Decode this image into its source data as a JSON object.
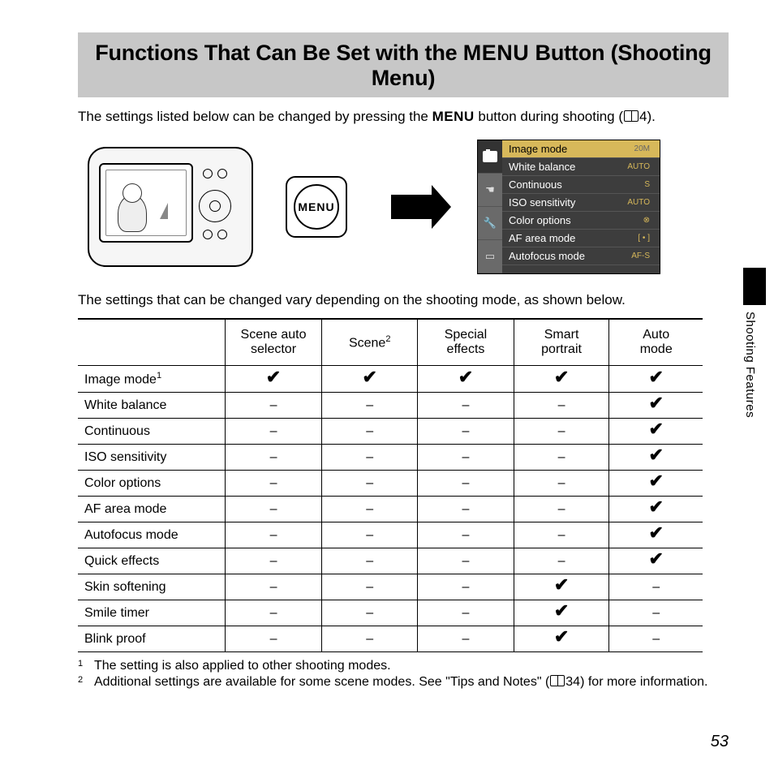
{
  "title": {
    "prefix": "Functions That Can Be Set with the ",
    "menu_word": "MENU",
    "suffix": " Button (Shooting Menu)"
  },
  "intro": {
    "prefix": "The settings listed below can be changed by pressing the ",
    "menu_word": "MENU",
    "mid": " button during shooting (",
    "ref": "4",
    "suffix": ")."
  },
  "menu_button_label": "MENU",
  "menu_screen": {
    "items": [
      {
        "label": "Image mode",
        "value": "20M",
        "selected": true
      },
      {
        "label": "White balance",
        "value": "AUTO"
      },
      {
        "label": "Continuous",
        "value": "S"
      },
      {
        "label": "ISO sensitivity",
        "value": "AUTO"
      },
      {
        "label": "Color options",
        "value": "⊗"
      },
      {
        "label": "AF area mode",
        "value": "[ • ]"
      },
      {
        "label": "Autofocus mode",
        "value": "AF-S"
      }
    ]
  },
  "para2": "The settings that can be changed vary depending on the shooting mode, as shown below.",
  "table": {
    "columns": [
      "Scene auto selector",
      "Scene",
      "Special effects",
      "Smart portrait",
      "Auto mode"
    ],
    "column_sup": [
      "",
      "2",
      "",
      "",
      ""
    ],
    "rows": [
      {
        "label": "Image mode",
        "sup": "1",
        "cells": [
          "w",
          "w",
          "w",
          "w",
          "w"
        ]
      },
      {
        "label": "White balance",
        "sup": "",
        "cells": [
          "–",
          "–",
          "–",
          "–",
          "w"
        ]
      },
      {
        "label": "Continuous",
        "sup": "",
        "cells": [
          "–",
          "–",
          "–",
          "–",
          "w"
        ]
      },
      {
        "label": "ISO sensitivity",
        "sup": "",
        "cells": [
          "–",
          "–",
          "–",
          "–",
          "w"
        ]
      },
      {
        "label": "Color options",
        "sup": "",
        "cells": [
          "–",
          "–",
          "–",
          "–",
          "w"
        ]
      },
      {
        "label": "AF area mode",
        "sup": "",
        "cells": [
          "–",
          "–",
          "–",
          "–",
          "w"
        ]
      },
      {
        "label": "Autofocus mode",
        "sup": "",
        "cells": [
          "–",
          "–",
          "–",
          "–",
          "w"
        ]
      },
      {
        "label": "Quick effects",
        "sup": "",
        "cells": [
          "–",
          "–",
          "–",
          "–",
          "w"
        ]
      },
      {
        "label": "Skin softening",
        "sup": "",
        "cells": [
          "–",
          "–",
          "–",
          "w",
          "–"
        ]
      },
      {
        "label": "Smile timer",
        "sup": "",
        "cells": [
          "–",
          "–",
          "–",
          "w",
          "–"
        ]
      },
      {
        "label": "Blink proof",
        "sup": "",
        "cells": [
          "–",
          "–",
          "–",
          "w",
          "–"
        ]
      }
    ]
  },
  "footnotes": [
    {
      "num": "1",
      "text": "The setting is also applied to other shooting modes."
    },
    {
      "num": "2",
      "text_prefix": "Additional settings are available for some scene modes. See \"Tips and Notes\" (",
      "ref": "34",
      "text_suffix": ") for more information."
    }
  ],
  "side_tab": "Shooting Features",
  "page_number": "53"
}
